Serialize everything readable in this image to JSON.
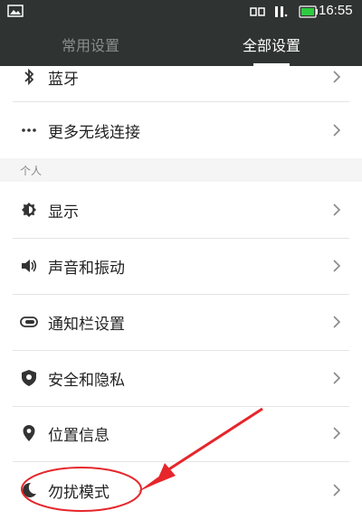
{
  "status": {
    "time": "16:55"
  },
  "tabs": [
    {
      "label": "常用设置",
      "active": false
    },
    {
      "label": "全部设置",
      "active": true
    }
  ],
  "items_top": [
    {
      "label": "蓝牙",
      "icon": "bluetooth-icon"
    },
    {
      "label": "更多无线连接",
      "icon": "more-dots-icon"
    }
  ],
  "section": {
    "label": "个人"
  },
  "items": [
    {
      "label": "显示",
      "icon": "brightness-icon"
    },
    {
      "label": "声音和振动",
      "icon": "volume-icon"
    },
    {
      "label": "通知栏设置",
      "icon": "toggle-icon"
    },
    {
      "label": "安全和隐私",
      "icon": "shield-icon"
    },
    {
      "label": "位置信息",
      "icon": "location-pin-icon"
    },
    {
      "label": "勿扰模式",
      "icon": "moon-icon"
    }
  ],
  "colors": {
    "topbar": "#2f3331",
    "annotation": "#e6262b"
  }
}
